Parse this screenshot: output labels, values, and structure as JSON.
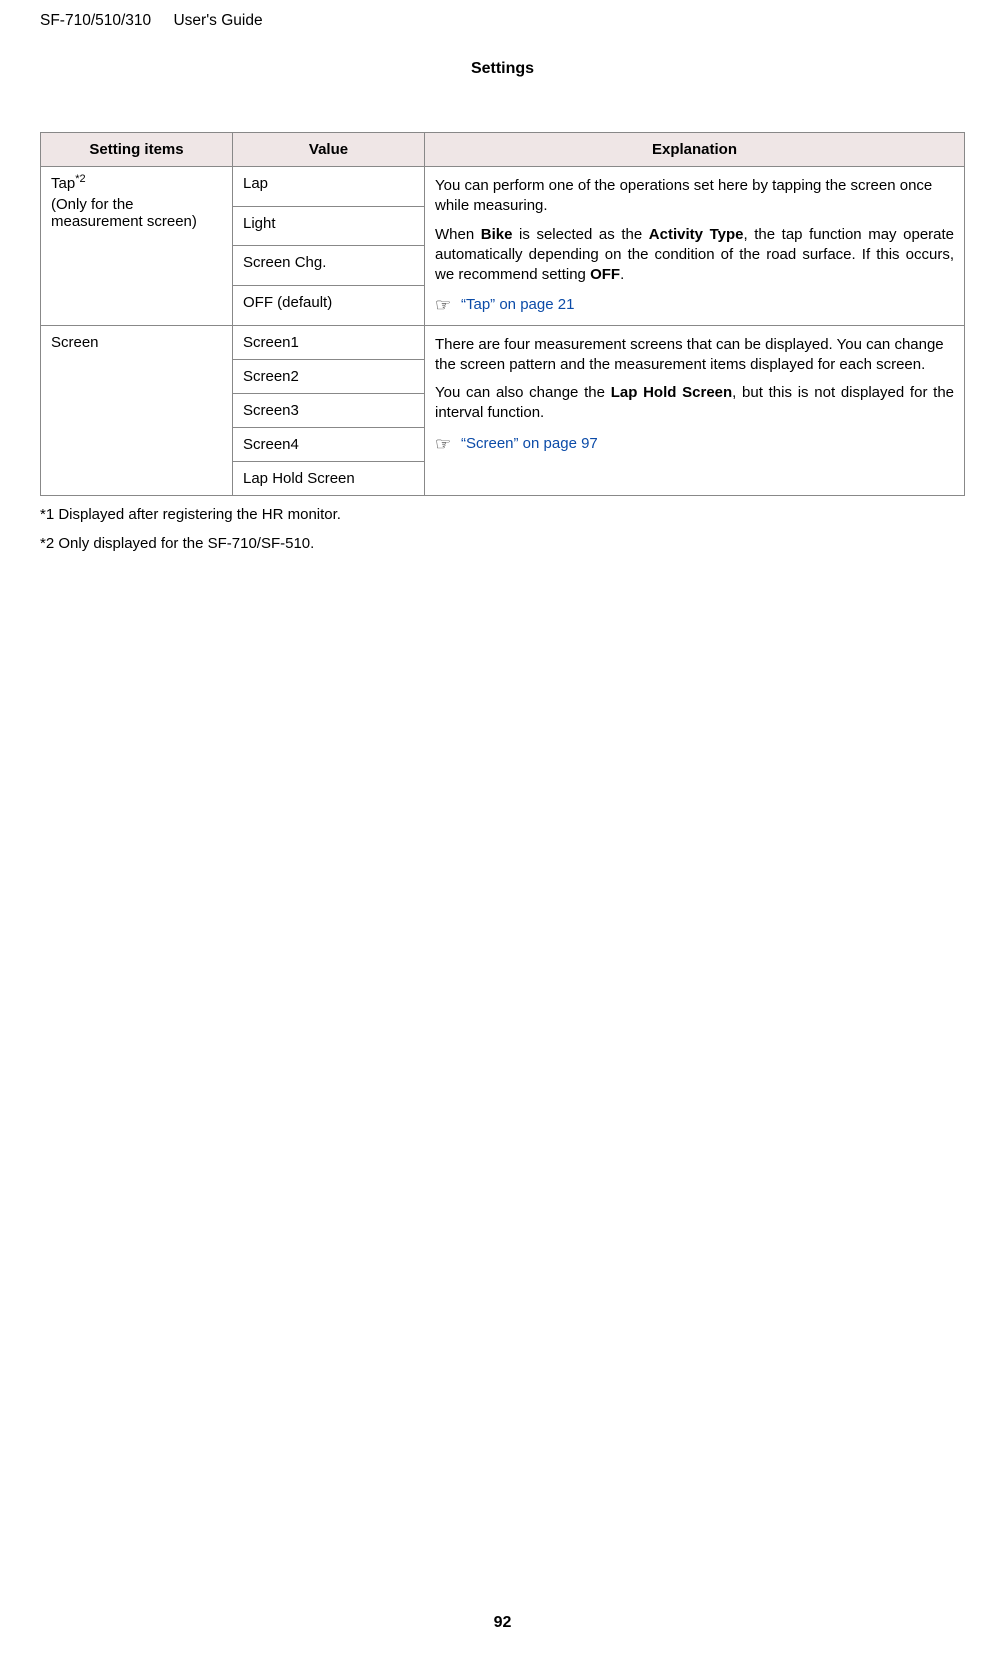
{
  "header": {
    "model": "SF-710/510/310",
    "guide": "User's Guide"
  },
  "pageTitle": "Settings",
  "table": {
    "headers": {
      "c1": "Setting items",
      "c2": "Value",
      "c3": "Explanation"
    },
    "rowTap": {
      "settingLabel": "Tap",
      "settingSup": "*2",
      "settingSub": "(Only for the measurement screen)",
      "values": {
        "v1": "Lap",
        "v2": "Light",
        "v3": "Screen Chg.",
        "v4": "OFF (default)"
      },
      "exp": {
        "p1": "You can perform one of the operations set here by tapping the screen once while measuring.",
        "p2a": "When ",
        "p2b": "Bike",
        "p2c": " is selected as the ",
        "p2d": "Activity Type",
        "p2e": ", the tap function may operate automatically depending on the condition of the road surface. If this occurs, we recommend setting ",
        "p2f": "OFF",
        "p2g": ".",
        "link": "“Tap” on page 21"
      }
    },
    "rowScreen": {
      "settingLabel": "Screen",
      "values": {
        "v1": "Screen1",
        "v2": "Screen2",
        "v3": "Screen3",
        "v4": "Screen4",
        "v5": "Lap Hold Screen"
      },
      "exp": {
        "p1": "There are four measurement screens that can be displayed. You can change the screen pattern and the measurement items displayed for each screen.",
        "p2a": "You can also change the ",
        "p2b": "Lap Hold Screen",
        "p2c": ", but this is not displayed for the interval function.",
        "link": "“Screen” on page 97"
      }
    }
  },
  "footnotes": {
    "f1": "*1 Displayed after registering the HR monitor.",
    "f2": "*2 Only displayed for the SF-710/SF-510."
  },
  "pageNumber": "92",
  "icon": "☞"
}
